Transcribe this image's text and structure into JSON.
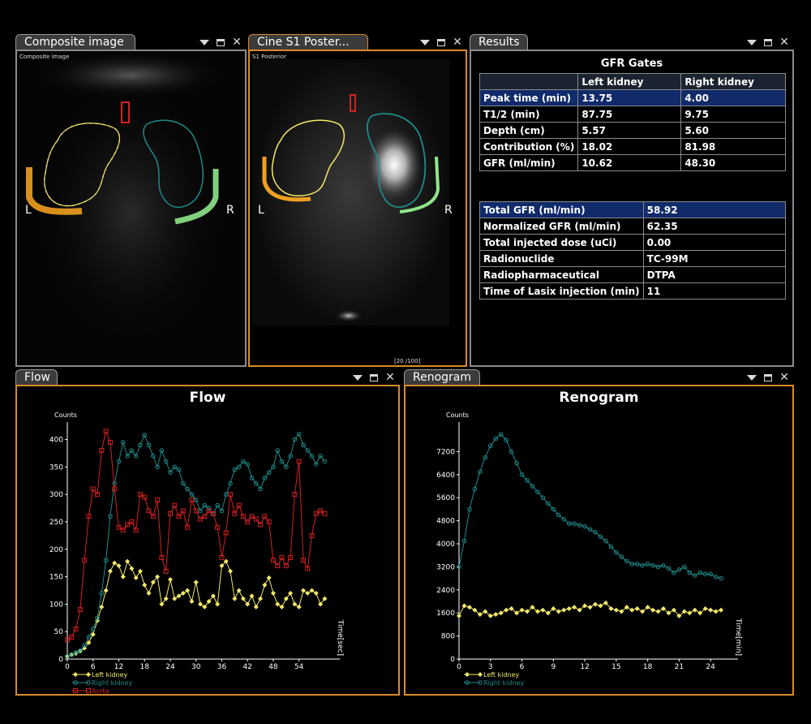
{
  "panels": {
    "composite": {
      "tab": "Composite image",
      "caption": "Composite image",
      "left_label": "L",
      "right_label": "R"
    },
    "cine": {
      "tab": "Cine S1 Poster...",
      "caption": "S1 Posterior",
      "left_label": "L",
      "right_label": "R",
      "frame_counter": "[20 /100]"
    },
    "results": {
      "tab": "Results",
      "title": "GFR Gates",
      "gates_headers": [
        "",
        "Left kidney",
        "Right kidney"
      ],
      "gates_rows": [
        {
          "label": "Peak time (min)",
          "left": "13.75",
          "right": "4.00",
          "highlight": true
        },
        {
          "label": "T1/2  (min)",
          "left": "87.75",
          "right": "9.75",
          "highlight": false
        },
        {
          "label": "Depth (cm)",
          "left": "5.57",
          "right": "5.60",
          "highlight": false
        },
        {
          "label": "Contribution (%)",
          "left": "18.02",
          "right": "81.98",
          "highlight": false
        },
        {
          "label": "GFR (ml/min)",
          "left": "10.62",
          "right": "48.30",
          "highlight": false
        }
      ],
      "summary_rows": [
        {
          "label": "Total GFR (ml/min)",
          "value": "58.92",
          "highlight": true
        },
        {
          "label": "Normalized GFR  (ml/min)",
          "value": "62.35",
          "highlight": false
        },
        {
          "label": "Total injected dose  (uCi)",
          "value": "0.00",
          "highlight": false
        },
        {
          "label": "Radionuclide",
          "value": "TC-99M",
          "highlight": false
        },
        {
          "label": "Radiopharmaceutical",
          "value": "DTPA",
          "highlight": false
        },
        {
          "label": "Time of Lasix injection (min)",
          "value": "11",
          "highlight": false
        }
      ]
    },
    "flow": {
      "tab": "Flow"
    },
    "renogram": {
      "tab": "Renogram"
    }
  },
  "colors": {
    "left_kidney": "#f2e86a",
    "right_kidney": "#1f8a8a",
    "aorta": "#d42020",
    "left_bg_roi": "#f0a020",
    "right_bg_roi": "#8ee68a",
    "active_border": "#d98a2c"
  },
  "chart_data": [
    {
      "type": "line",
      "title": "Flow",
      "ylabel": "Counts",
      "xlabel": "Time[sec]",
      "xlim": [
        0,
        62
      ],
      "ylim": [
        0,
        420
      ],
      "xticks": [
        0,
        6,
        12,
        18,
        24,
        30,
        36,
        42,
        48,
        54
      ],
      "yticks": [
        0,
        50,
        100,
        150,
        200,
        250,
        300,
        350,
        400
      ],
      "series": [
        {
          "name": "Left kidney",
          "color": "#f2e86a",
          "marker": "diamond",
          "x": [
            0,
            1,
            2,
            3,
            4,
            5,
            6,
            7,
            8,
            9,
            10,
            11,
            12,
            13,
            14,
            15,
            16,
            17,
            18,
            19,
            20,
            21,
            22,
            23,
            24,
            25,
            26,
            27,
            28,
            29,
            30,
            31,
            32,
            33,
            34,
            35,
            36,
            37,
            38,
            39,
            40,
            41,
            42,
            43,
            44,
            45,
            46,
            47,
            48,
            49,
            50,
            51,
            52,
            53,
            54,
            55,
            56,
            57,
            58,
            59,
            60
          ],
          "values": [
            5,
            8,
            10,
            14,
            20,
            30,
            45,
            70,
            95,
            125,
            160,
            175,
            170,
            150,
            178,
            165,
            148,
            160,
            135,
            120,
            140,
            150,
            100,
            110,
            145,
            110,
            115,
            120,
            125,
            105,
            140,
            100,
            95,
            105,
            115,
            100,
            170,
            178,
            160,
            110,
            125,
            110,
            100,
            115,
            95,
            110,
            135,
            148,
            120,
            100,
            95,
            110,
            120,
            100,
            95,
            125,
            120,
            125,
            120,
            100,
            110
          ]
        },
        {
          "name": "Right kidney",
          "color": "#1f8a8a",
          "marker": "circle",
          "x": [
            0,
            1,
            2,
            3,
            4,
            5,
            6,
            7,
            8,
            9,
            10,
            11,
            12,
            13,
            14,
            15,
            16,
            17,
            18,
            19,
            20,
            21,
            22,
            23,
            24,
            25,
            26,
            27,
            28,
            29,
            30,
            31,
            32,
            33,
            34,
            35,
            36,
            37,
            38,
            39,
            40,
            41,
            42,
            43,
            44,
            45,
            46,
            47,
            48,
            49,
            50,
            51,
            52,
            53,
            54,
            55,
            56,
            57,
            58,
            59,
            60
          ],
          "values": [
            5,
            8,
            12,
            15,
            25,
            40,
            55,
            75,
            120,
            180,
            260,
            320,
            360,
            395,
            370,
            380,
            370,
            390,
            408,
            390,
            370,
            350,
            380,
            360,
            340,
            350,
            345,
            320,
            310,
            300,
            290,
            270,
            280,
            275,
            265,
            280,
            270,
            300,
            320,
            345,
            350,
            360,
            355,
            330,
            320,
            310,
            330,
            340,
            350,
            380,
            360,
            350,
            370,
            400,
            410,
            390,
            380,
            370,
            355,
            370,
            360
          ]
        },
        {
          "name": "Aorta",
          "color": "#d42020",
          "marker": "square",
          "x": [
            0,
            1,
            2,
            3,
            4,
            5,
            6,
            7,
            8,
            9,
            10,
            11,
            12,
            13,
            14,
            15,
            16,
            17,
            18,
            19,
            20,
            21,
            22,
            23,
            24,
            25,
            26,
            27,
            28,
            29,
            30,
            31,
            32,
            33,
            34,
            35,
            36,
            37,
            38,
            39,
            40,
            41,
            42,
            43,
            44,
            45,
            46,
            47,
            48,
            49,
            50,
            51,
            52,
            53,
            54,
            55,
            56,
            57,
            58,
            59,
            60
          ],
          "values": [
            35,
            40,
            55,
            90,
            180,
            260,
            310,
            300,
            380,
            415,
            395,
            310,
            240,
            235,
            245,
            250,
            235,
            300,
            295,
            270,
            260,
            290,
            185,
            160,
            265,
            280,
            260,
            270,
            240,
            290,
            270,
            255,
            260,
            270,
            265,
            240,
            185,
            230,
            300,
            265,
            280,
            260,
            250,
            260,
            255,
            245,
            260,
            250,
            180,
            170,
            185,
            170,
            185,
            300,
            360,
            180,
            165,
            225,
            265,
            270,
            265
          ]
        }
      ]
    },
    {
      "type": "line",
      "title": "Renogram",
      "ylabel": "Counts",
      "xlabel": "Time[min]",
      "xlim": [
        0,
        26
      ],
      "ylim": [
        0,
        8000
      ],
      "xticks": [
        0,
        3,
        6,
        9,
        12,
        15,
        18,
        21,
        24
      ],
      "yticks": [
        0,
        800,
        1600,
        2400,
        3200,
        4000,
        4800,
        5600,
        6400,
        7200
      ],
      "series": [
        {
          "name": "Left kidney",
          "color": "#f2e86a",
          "marker": "diamond",
          "x": [
            0,
            0.5,
            1,
            1.5,
            2,
            2.5,
            3,
            3.5,
            4,
            4.5,
            5,
            5.5,
            6,
            6.5,
            7,
            7.5,
            8,
            8.5,
            9,
            9.5,
            10,
            10.5,
            11,
            11.5,
            12,
            12.5,
            13,
            13.5,
            14,
            14.5,
            15,
            15.5,
            16,
            16.5,
            17,
            17.5,
            18,
            18.5,
            19,
            19.5,
            20,
            20.5,
            21,
            21.5,
            22,
            22.5,
            23,
            23.5,
            24,
            24.5,
            25
          ],
          "values": [
            1500,
            1850,
            1800,
            1700,
            1550,
            1650,
            1500,
            1550,
            1600,
            1700,
            1750,
            1600,
            1700,
            1650,
            1800,
            1650,
            1700,
            1600,
            1750,
            1650,
            1700,
            1750,
            1800,
            1700,
            1850,
            1800,
            1900,
            1850,
            1950,
            1750,
            1700,
            1650,
            1800,
            1700,
            1750,
            1650,
            1800,
            1700,
            1650,
            1750,
            1600,
            1700,
            1500,
            1650,
            1600,
            1700,
            1600,
            1750,
            1700,
            1650,
            1700
          ]
        },
        {
          "name": "Right kidney",
          "color": "#1f8a8a",
          "marker": "circle",
          "x": [
            0,
            0.5,
            1,
            1.5,
            2,
            2.5,
            3,
            3.5,
            4,
            4.5,
            5,
            5.5,
            6,
            6.5,
            7,
            7.5,
            8,
            8.5,
            9,
            9.5,
            10,
            10.5,
            11,
            11.5,
            12,
            12.5,
            13,
            13.5,
            14,
            14.5,
            15,
            15.5,
            16,
            16.5,
            17,
            17.5,
            18,
            18.5,
            19,
            19.5,
            20,
            20.5,
            21,
            21.5,
            22,
            22.5,
            23,
            23.5,
            24,
            24.5,
            25
          ],
          "values": [
            3200,
            4100,
            5200,
            5900,
            6500,
            7000,
            7400,
            7650,
            7800,
            7600,
            7200,
            6800,
            6400,
            6200,
            6000,
            5800,
            5600,
            5400,
            5200,
            5000,
            4850,
            4700,
            4700,
            4650,
            4600,
            4500,
            4400,
            4250,
            4100,
            3900,
            3700,
            3550,
            3400,
            3300,
            3300,
            3250,
            3300,
            3250,
            3200,
            3250,
            3150,
            3000,
            3100,
            3200,
            3000,
            2900,
            3000,
            2950,
            2950,
            2850,
            2800
          ]
        }
      ]
    }
  ]
}
